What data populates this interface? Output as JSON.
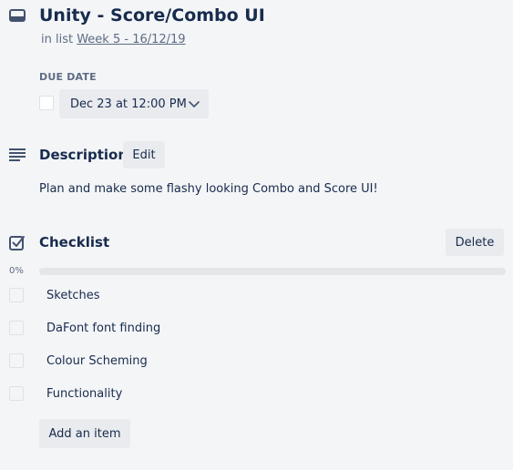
{
  "card": {
    "title": "Unity - Score/Combo UI",
    "in_list_prefix": "in list",
    "list_name": "Week 5 - 16/12/19",
    "icon": "card-icon"
  },
  "due_date": {
    "label": "DUE DATE",
    "value": "Dec 23 at 12:00 PM",
    "checked": false,
    "dropdown_icon": "chevron-down-icon"
  },
  "description": {
    "icon": "description-icon",
    "title": "Description",
    "edit_label": "Edit",
    "text": "Plan and make some flashy looking Combo and Score UI!"
  },
  "checklist": {
    "icon": "checklist-icon",
    "title": "Checklist",
    "delete_label": "Delete",
    "progress_text": "0%",
    "progress": 0,
    "items": [
      {
        "label": "Sketches",
        "checked": false
      },
      {
        "label": "DaFont font finding",
        "checked": false
      },
      {
        "label": "Colour Scheming",
        "checked": false
      },
      {
        "label": "Functionality",
        "checked": false
      }
    ],
    "add_item_label": "Add an item"
  },
  "colors": {
    "background": "#f4f5f7",
    "button_bg": "#e9ebee",
    "text": "#172b4d",
    "muted": "#5e6c84",
    "progress_track": "#e4e6ea"
  }
}
